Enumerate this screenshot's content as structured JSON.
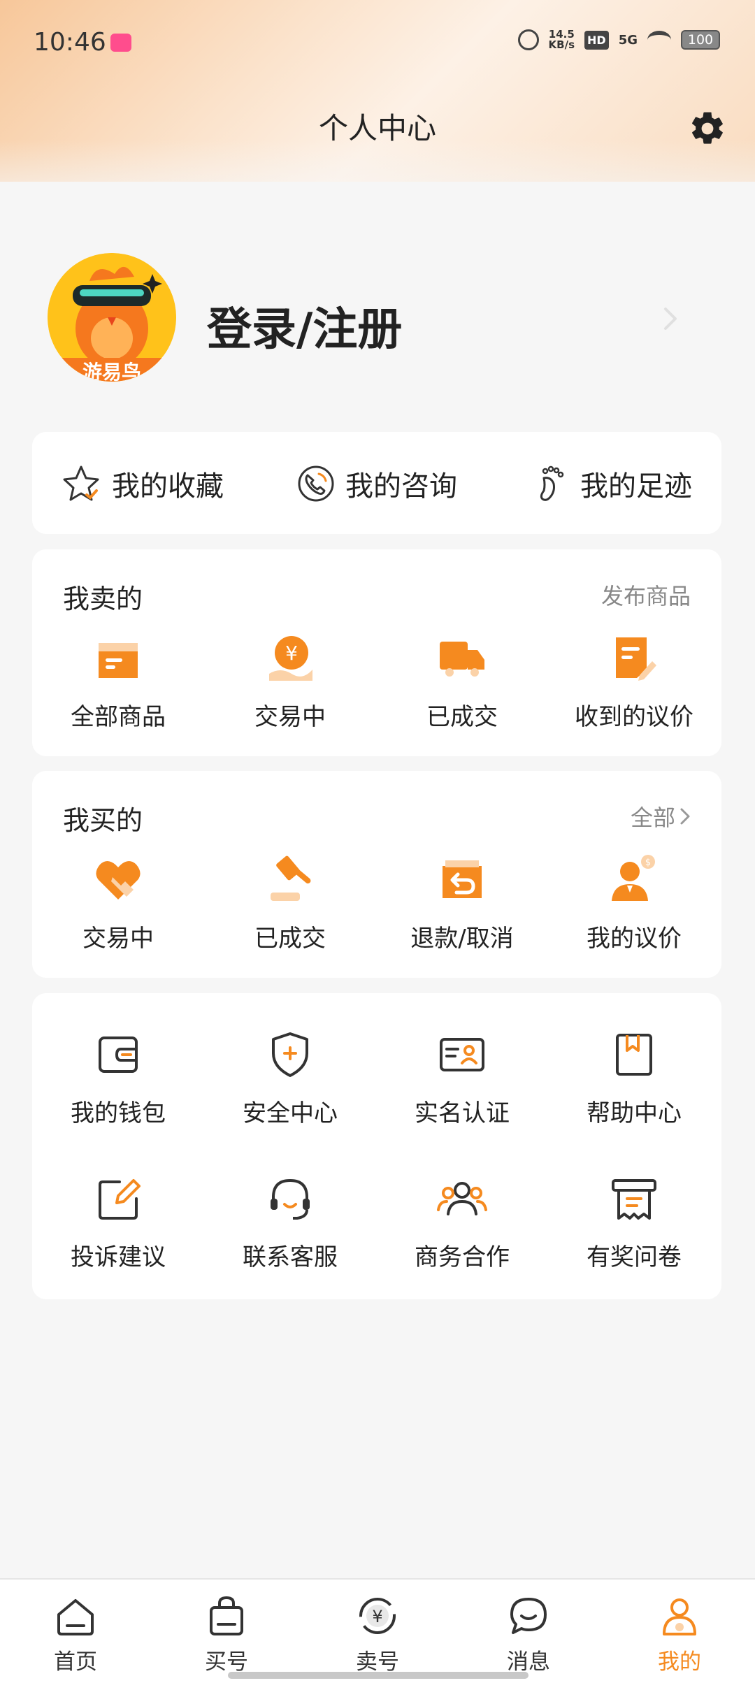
{
  "status_bar": {
    "time": "10:46",
    "net_speed_value": "14.5",
    "net_speed_unit": "KB/s",
    "hd": "HD",
    "network": "5G",
    "battery": "100"
  },
  "header": {
    "title": "个人中心",
    "settings_icon": "gear-icon"
  },
  "profile": {
    "avatar_text": "游易鸟",
    "login_label": "登录/注册"
  },
  "quick_links": [
    {
      "label": "我的收藏",
      "icon": "star-icon"
    },
    {
      "label": "我的咨询",
      "icon": "phone-icon"
    },
    {
      "label": "我的足迹",
      "icon": "footprint-icon"
    }
  ],
  "selling": {
    "title": "我卖的",
    "action": "发布商品",
    "items": [
      {
        "label": "全部商品",
        "icon": "box-icon"
      },
      {
        "label": "交易中",
        "icon": "coin-hand-icon"
      },
      {
        "label": "已成交",
        "icon": "truck-icon"
      },
      {
        "label": "收到的议价",
        "icon": "note-pen-icon"
      }
    ]
  },
  "buying": {
    "title": "我买的",
    "action": "全部",
    "items": [
      {
        "label": "交易中",
        "icon": "handshake-icon"
      },
      {
        "label": "已成交",
        "icon": "gavel-icon"
      },
      {
        "label": "退款/取消",
        "icon": "refund-box-icon"
      },
      {
        "label": "我的议价",
        "icon": "person-coin-icon"
      }
    ]
  },
  "services": [
    {
      "label": "我的钱包",
      "icon": "wallet-icon"
    },
    {
      "label": "安全中心",
      "icon": "shield-icon"
    },
    {
      "label": "实名认证",
      "icon": "id-card-icon"
    },
    {
      "label": "帮助中心",
      "icon": "bookmark-book-icon"
    },
    {
      "label": "投诉建议",
      "icon": "edit-icon"
    },
    {
      "label": "联系客服",
      "icon": "headset-icon"
    },
    {
      "label": "商务合作",
      "icon": "users-icon"
    },
    {
      "label": "有奖问卷",
      "icon": "survey-icon"
    }
  ],
  "bottom_nav": [
    {
      "label": "首页",
      "icon": "home-icon"
    },
    {
      "label": "买号",
      "icon": "bag-icon"
    },
    {
      "label": "卖号",
      "icon": "yen-exchange-icon"
    },
    {
      "label": "消息",
      "icon": "chat-icon"
    },
    {
      "label": "我的",
      "icon": "person-icon",
      "active": true
    }
  ],
  "colors": {
    "accent": "#f58a1f",
    "accent_light": "#fbd2a8",
    "text": "#222222",
    "muted": "#888888"
  }
}
